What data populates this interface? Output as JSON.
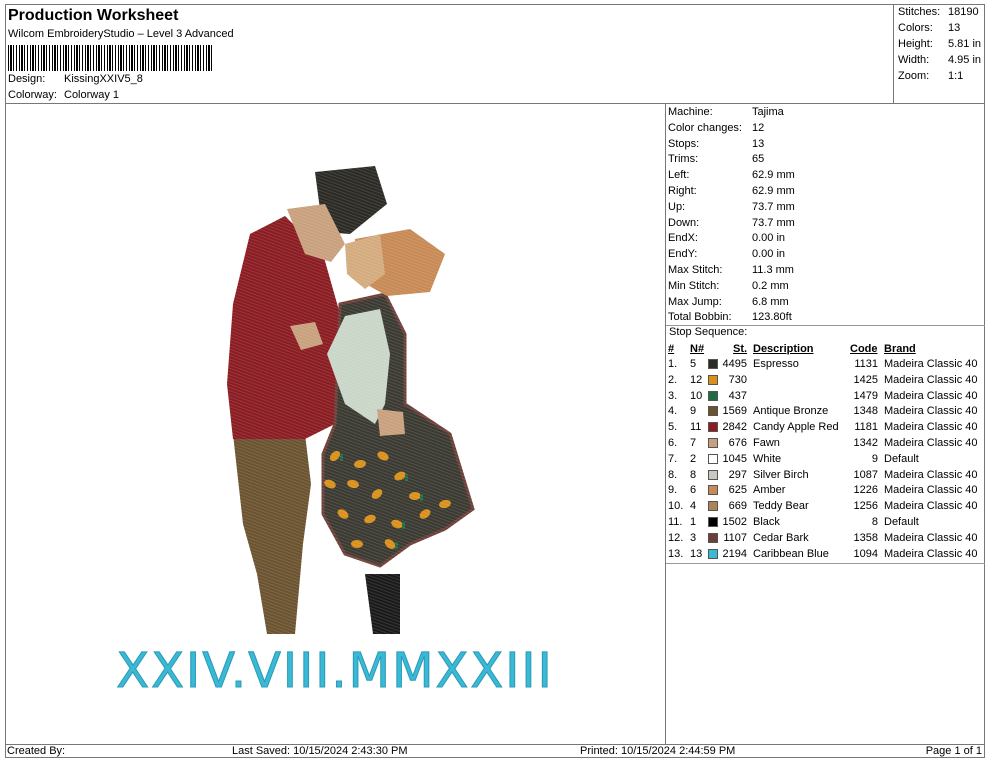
{
  "header": {
    "title": "Production Worksheet",
    "subtitle": "Wilcom EmbroideryStudio – Level 3 Advanced",
    "design_label": "Design:",
    "design_value": "KissingXXIV5_8",
    "colorway_label": "Colorway:",
    "colorway_value": "Colorway 1"
  },
  "stats": [
    {
      "label": "Stitches:",
      "value": "18190"
    },
    {
      "label": "Colors:",
      "value": "13"
    },
    {
      "label": "Height:",
      "value": "5.81 in"
    },
    {
      "label": "Width:",
      "value": "4.95 in"
    },
    {
      "label": "Zoom:",
      "value": "1:1"
    }
  ],
  "machine_info": [
    {
      "label": "Machine:",
      "value": "Tajima"
    },
    {
      "label": "Color changes:",
      "value": "12"
    },
    {
      "label": "Stops:",
      "value": "13"
    },
    {
      "label": "Trims:",
      "value": "65"
    },
    {
      "label": "Left:",
      "value": "62.9 mm"
    },
    {
      "label": "Right:",
      "value": "62.9 mm"
    },
    {
      "label": "Up:",
      "value": "73.7 mm"
    },
    {
      "label": "Down:",
      "value": "73.7 mm"
    },
    {
      "label": "EndX:",
      "value": "0.00 in"
    },
    {
      "label": "EndY:",
      "value": "0.00 in"
    },
    {
      "label": "Max Stitch:",
      "value": "11.3 mm"
    },
    {
      "label": "Min Stitch:",
      "value": "0.2 mm"
    },
    {
      "label": "Max Jump:",
      "value": "6.8 mm"
    },
    {
      "label": "Total Bobbin:",
      "value": "123.80ft"
    }
  ],
  "stop_sequence": {
    "title": "Stop Sequence:",
    "headers": {
      "idx": "#",
      "n": "N#",
      "st": "St.",
      "desc": "Description",
      "code": "Code",
      "brand": "Brand"
    },
    "rows": [
      {
        "idx": "1.",
        "n": "5",
        "color": "#2b2a24",
        "st": "4495",
        "desc": "Espresso",
        "code": "1131",
        "brand": "Madeira Classic 40"
      },
      {
        "idx": "2.",
        "n": "12",
        "color": "#d9901a",
        "st": "730",
        "desc": "",
        "code": "1425",
        "brand": "Madeira Classic 40"
      },
      {
        "idx": "3.",
        "n": "10",
        "color": "#1f6b45",
        "st": "437",
        "desc": "",
        "code": "1479",
        "brand": "Madeira Classic 40"
      },
      {
        "idx": "4.",
        "n": "9",
        "color": "#6b5330",
        "st": "1569",
        "desc": "Antique Bronze",
        "code": "1348",
        "brand": "Madeira Classic 40"
      },
      {
        "idx": "5.",
        "n": "11",
        "color": "#8a1c22",
        "st": "2842",
        "desc": "Candy Apple Red",
        "code": "1181",
        "brand": "Madeira Classic 40"
      },
      {
        "idx": "6.",
        "n": "7",
        "color": "#c8a07e",
        "st": "676",
        "desc": "Fawn",
        "code": "1342",
        "brand": "Madeira Classic 40"
      },
      {
        "idx": "7.",
        "n": "2",
        "color": "#ffffff",
        "st": "1045",
        "desc": "White",
        "code": "9",
        "brand": "Default"
      },
      {
        "idx": "8.",
        "n": "8",
        "color": "#c9c9c4",
        "st": "297",
        "desc": "Silver Birch",
        "code": "1087",
        "brand": "Madeira Classic 40"
      },
      {
        "idx": "9.",
        "n": "6",
        "color": "#c78a55",
        "st": "625",
        "desc": "Amber",
        "code": "1226",
        "brand": "Madeira Classic 40"
      },
      {
        "idx": "10.",
        "n": "4",
        "color": "#a88456",
        "st": "669",
        "desc": "Teddy Bear",
        "code": "1256",
        "brand": "Madeira Classic 40"
      },
      {
        "idx": "11.",
        "n": "1",
        "color": "#000000",
        "st": "1502",
        "desc": "Black",
        "code": "8",
        "brand": "Default"
      },
      {
        "idx": "12.",
        "n": "3",
        "color": "#6b3f38",
        "st": "1107",
        "desc": "Cedar Bark",
        "code": "1358",
        "brand": "Madeira Classic 40"
      },
      {
        "idx": "13.",
        "n": "13",
        "color": "#3ab9d6",
        "st": "2194",
        "desc": "Caribbean Blue",
        "code": "1094",
        "brand": "Madeira Classic 40"
      }
    ]
  },
  "design": {
    "roman_text": "XXIV.VIII.MMXXIII",
    "colors": {
      "hair_man": "#2b2a24",
      "skin": "#c8a07e",
      "jacket": "#8a1c22",
      "pants": "#6b5330",
      "hair_woman": "#c78a55",
      "sleeve": "#c9d6c8",
      "dress": "#3a3a32",
      "dress_trim": "#6b3f38",
      "flowers": "#d9901a",
      "leaves": "#1f6b45",
      "text": "#3ab9d6"
    }
  },
  "footer": {
    "created_by": "Created By:",
    "last_saved": "Last Saved: 10/15/2024 2:43:30 PM",
    "printed": "Printed: 10/15/2024 2:44:59 PM",
    "page": "Page 1 of 1"
  }
}
